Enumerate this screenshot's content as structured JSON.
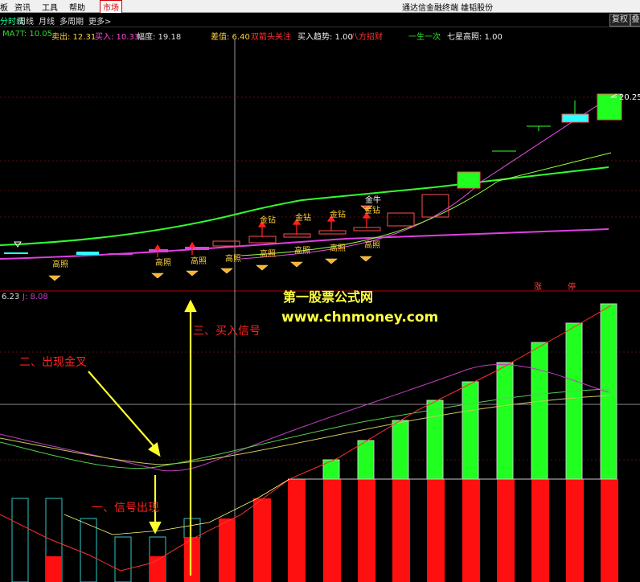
{
  "menu": {
    "items": [
      "板",
      "资讯",
      "工具",
      "帮助"
    ],
    "market": "市场",
    "title": "通达信金融终端  雄韬股份"
  },
  "tabs": {
    "items": [
      "分时线",
      "周线",
      "月线",
      "多周期",
      "更多>"
    ],
    "right": [
      "复权",
      "叠加"
    ]
  },
  "indicators": {
    "ma7": "MA7T: 10.05",
    "sell": "卖出: 12.31",
    "buy": "买入: 10.33",
    "amp": "幅度: 19.18",
    "diff": "差值: 6.40",
    "lead": "双箭头关注",
    "trend": "买入趋势: 1.00",
    "bagua": "八方招财",
    "one": "一生一次",
    "star": "七星高照: 1.00"
  },
  "price": {
    "high": "20.25"
  },
  "marks": {
    "gaozhao": "高照",
    "jinzuan": "金钻",
    "jinniu": "金牛",
    "zhang": "涨",
    "ting": "停"
  },
  "lower": {
    "left": "6.23",
    "j": "J: 8.08"
  },
  "watermark": {
    "cn": "第一股票公式网",
    "url": "www.chnmoney.com"
  },
  "annotations": {
    "a1": "一、信号出现",
    "a2": "二、出现金叉",
    "a3": "三、买入信号"
  },
  "colors": {
    "bg": "#000000",
    "up": "#ff2020",
    "green": "#20ff20",
    "yellow": "#ffff40",
    "magenta": "#e040e0"
  }
}
